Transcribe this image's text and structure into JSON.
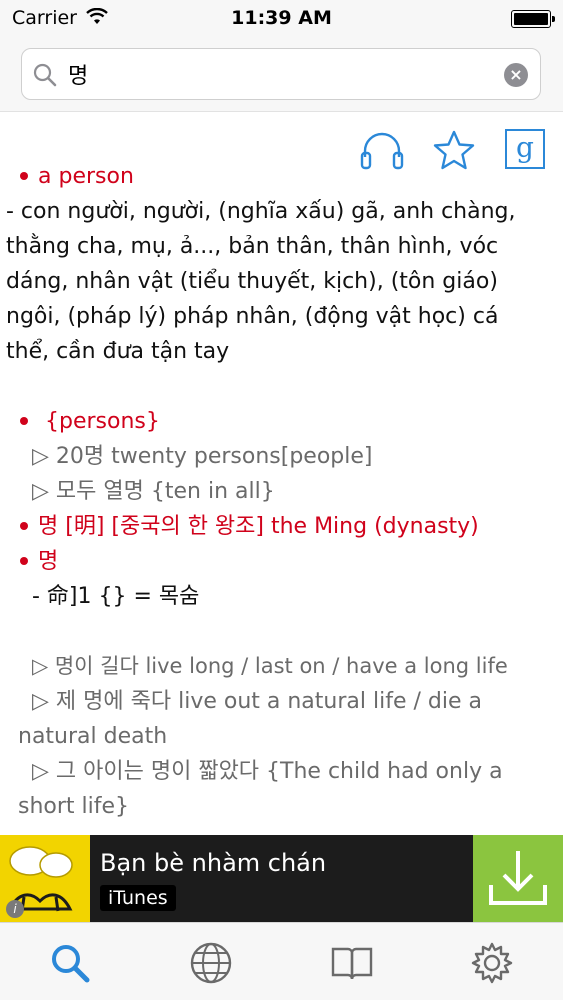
{
  "status": {
    "carrier": "Carrier",
    "time": "11:39 AM",
    "battery_level": 1.0
  },
  "search": {
    "query": "명",
    "icon": "search-icon",
    "clear_icon": "clear-icon"
  },
  "actions": {
    "audio_icon": "headphones-icon",
    "favorite_icon": "star-icon",
    "google_label": "g"
  },
  "entry": {
    "sense1_heading": "a person",
    "sense1_def": "-  con người, người, (nghĩa xấu) gã, anh chàng, thằng cha, mụ, ả..., bản thân, thân hình, vóc dáng, nhân vật (tiểu thuyết, kịch), (tôn giáo) ngôi, (pháp lý) pháp nhân, (động vật học) cá thể, cần đưa tận tay",
    "sense2_heading": " {persons}",
    "sense2_ex1": "▷ 20명 twenty persons[people]",
    "sense2_ex2": "▷ 모두 열명 {ten in all}",
    "sense3_heading": "명 [明] [중국의 한 왕조] the Ming (dynasty)",
    "sense4_heading": "명",
    "sense4_def": "- 命]1 {} = 목숨",
    "sense4_ex1": "▷ 명이 길다 live long / last on / have a long life",
    "sense4_ex2": "▷ 제 명에 죽다 live out a natural life / die a natural death",
    "sense4_ex3": "▷ 그 아이는 명이 짧았다 {The child had only a short life}"
  },
  "ad": {
    "title": "Bạn bè nhàm chán",
    "store": "iTunes",
    "info": "i"
  },
  "tabs": [
    {
      "icon": "search-icon",
      "active": true
    },
    {
      "icon": "globe-icon",
      "active": false
    },
    {
      "icon": "book-icon",
      "active": false
    },
    {
      "icon": "gear-icon",
      "active": false
    }
  ],
  "colors": {
    "accent": "#2b88d8",
    "heading_red": "#d0021b",
    "example_gray": "#6a6a6a",
    "ad_green": "#8bc53f",
    "ad_yellow": "#f2d400"
  }
}
